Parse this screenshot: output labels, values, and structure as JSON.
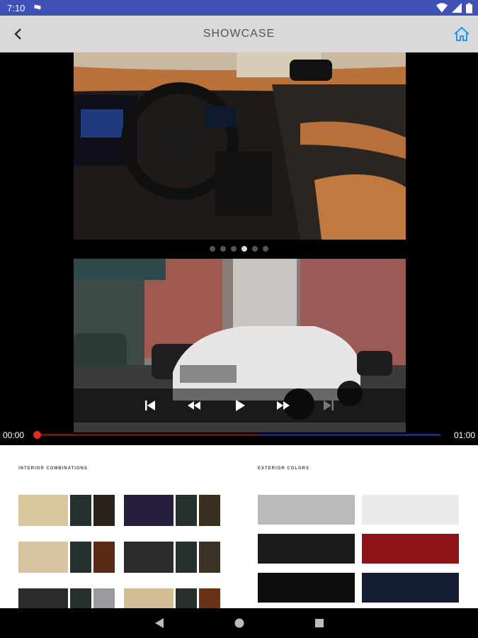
{
  "status": {
    "time": "7:10"
  },
  "appbar": {
    "title": "SHOWCASE"
  },
  "gallery": {
    "dot_count": 6,
    "active_dot": 3
  },
  "video": {
    "current_time": "00:00",
    "duration": "01:00",
    "progress": 0.0,
    "buffered": 0.55
  },
  "brochure": {
    "interior_heading": "INTERIOR COMBINATIONS",
    "exterior_heading": "EXTERIOR COLORS",
    "exterior_swatches": [
      {
        "color": "#b8babc"
      },
      {
        "color": "#e9eaeb"
      },
      {
        "color": "#1b1b1c"
      },
      {
        "color": "#8e1418"
      },
      {
        "color": "#0d0d0e"
      },
      {
        "color": "#141e33"
      }
    ]
  },
  "colors": {
    "status_bar": "#3f51b5",
    "accent": "#2196f3",
    "seek_thumb": "#e32b1f"
  }
}
